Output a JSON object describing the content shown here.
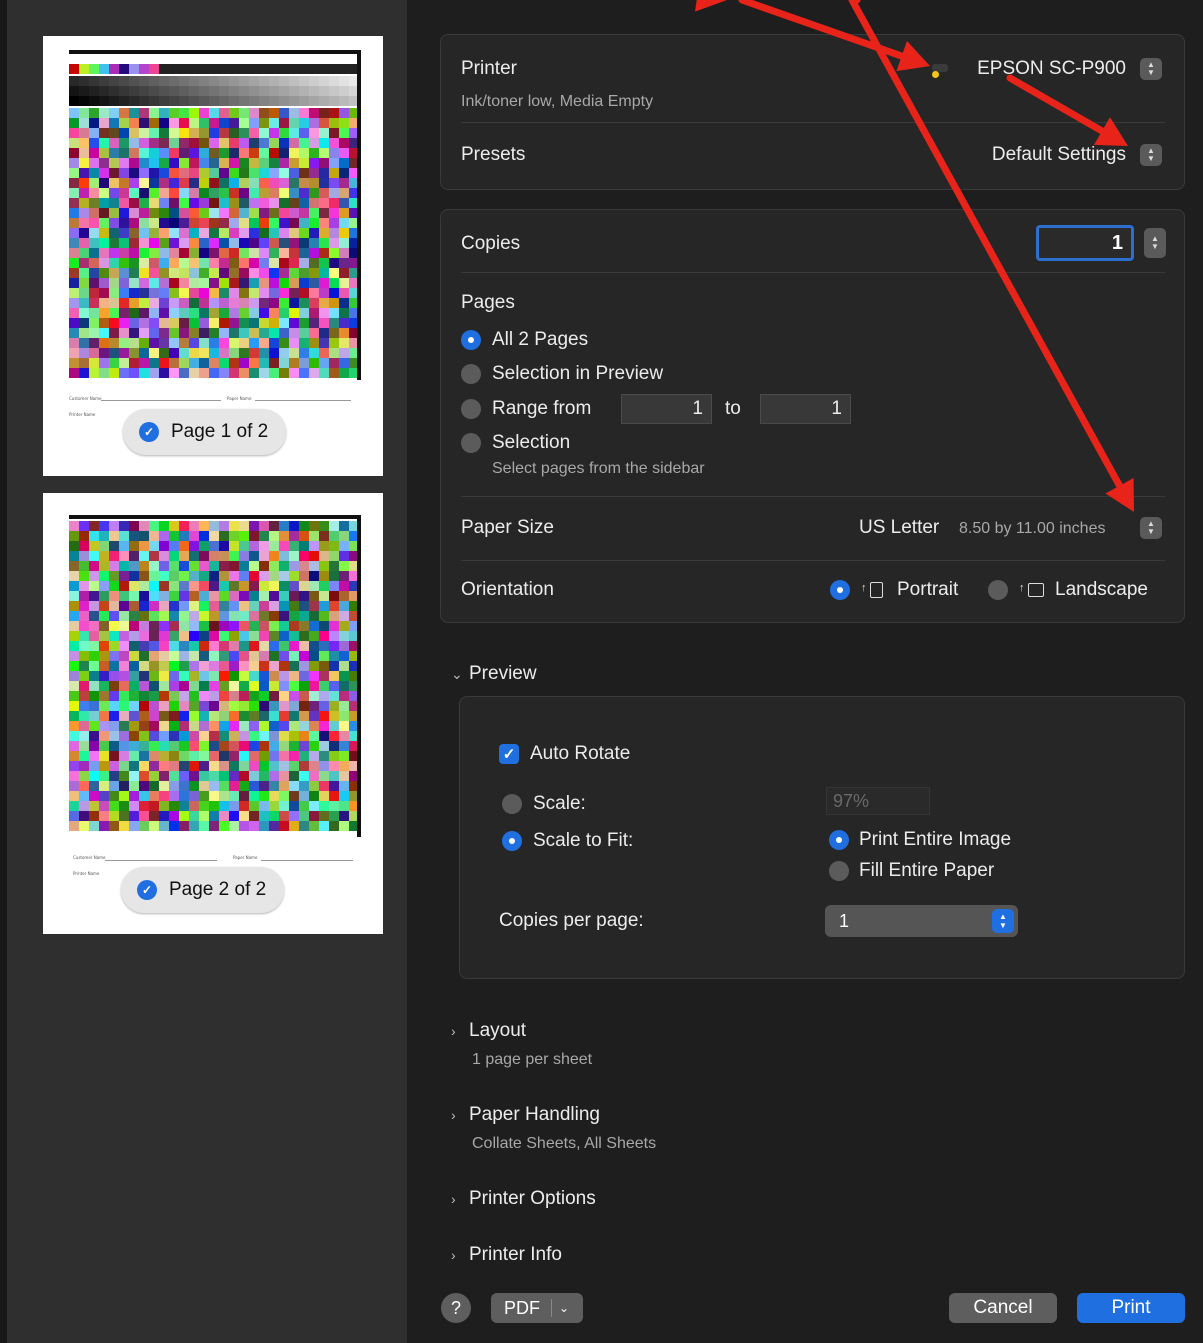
{
  "sidebar": {
    "pages": [
      {
        "label": "Page 1 of 2"
      },
      {
        "label": "Page 2 of 2"
      }
    ],
    "thumb_fields": {
      "customer": "Customer Name",
      "paper": "Paper Name",
      "printer": "Printer Name"
    }
  },
  "printer_box": {
    "printer_label": "Printer",
    "printer_value": "EPSON SC-P900",
    "printer_status": "Ink/toner low, Media Empty",
    "presets_label": "Presets",
    "presets_value": "Default Settings"
  },
  "copies_box": {
    "copies_label": "Copies",
    "copies_value": "1",
    "pages_label": "Pages",
    "page_options": [
      {
        "label": "All 2 Pages",
        "selected": true
      },
      {
        "label": "Selection in Preview",
        "selected": false
      },
      {
        "label": "Range from",
        "selected": false
      },
      {
        "label": "Selection",
        "selected": false
      }
    ],
    "range_from": "1",
    "range_to_label": "to",
    "range_to": "1",
    "selection_hint": "Select pages from the sidebar",
    "paper_size_label": "Paper Size",
    "paper_size_value": "US Letter",
    "paper_size_detail": "8.50 by 11.00 inches",
    "orientation_label": "Orientation",
    "orientation_options": [
      {
        "label": "Portrait",
        "selected": true
      },
      {
        "label": "Landscape",
        "selected": false
      }
    ]
  },
  "preview_section": {
    "title": "Preview",
    "auto_rotate": "Auto Rotate",
    "scale_label": "Scale:",
    "scale_value": "97%",
    "scale_to_fit_label": "Scale to Fit:",
    "fit_options": [
      {
        "label": "Print Entire Image",
        "selected": true
      },
      {
        "label": "Fill Entire Paper",
        "selected": false
      }
    ],
    "copies_per_page_label": "Copies per page:",
    "copies_per_page_value": "1"
  },
  "collapsed_sections": [
    {
      "title": "Layout",
      "summary": "1 page per sheet"
    },
    {
      "title": "Paper Handling",
      "summary": "Collate Sheets, All Sheets"
    },
    {
      "title": "Printer Options",
      "summary": ""
    },
    {
      "title": "Printer Info",
      "summary": ""
    }
  ],
  "footer": {
    "help": "?",
    "pdf": "PDF",
    "cancel": "Cancel",
    "print": "Print"
  },
  "colors": {
    "accent": "#1f6fe0",
    "annotation_arrow": "#e8231a",
    "status_dot": "#f5c518"
  }
}
